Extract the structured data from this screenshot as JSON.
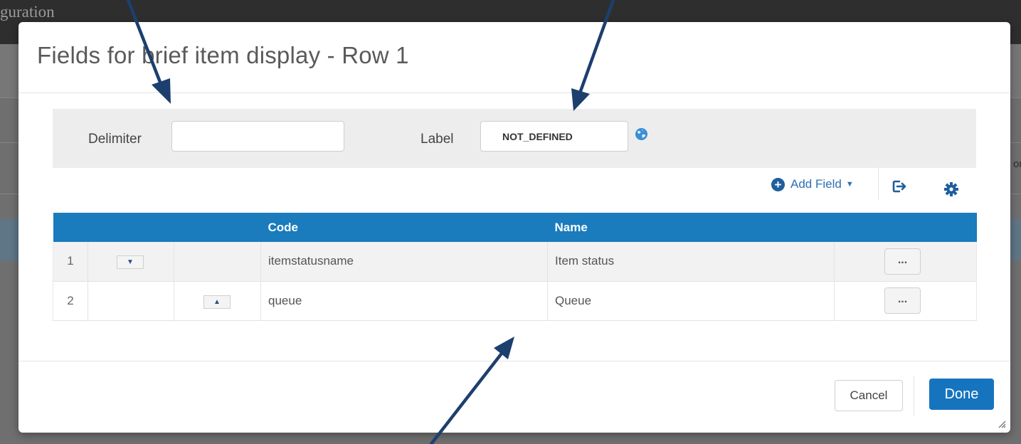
{
  "background": {
    "app_title": "guration",
    "side_text": "or"
  },
  "modal": {
    "title": "Fields for brief item display - Row 1",
    "delimiter": {
      "label": "Delimiter",
      "value": ""
    },
    "label_field": {
      "label": "Label",
      "value": "NOT_DEFINED",
      "icon": "globe-icon"
    },
    "toolbar": {
      "add_field_label": "Add Field",
      "add_field_icon": "plus-circle-icon",
      "caret_icon": "caret-down-icon",
      "export_icon": "export-icon",
      "settings_icon": "gear-icon"
    },
    "table": {
      "headers": [
        "",
        "",
        "",
        "Code",
        "Name",
        ""
      ],
      "rows": [
        {
          "index": "1",
          "code": "itemstatusname",
          "name": "Item status",
          "actions_label": "..."
        },
        {
          "index": "2",
          "code": "queue",
          "name": "Queue",
          "actions_label": "..."
        }
      ]
    },
    "footer": {
      "cancel_label": "Cancel",
      "done_label": "Done"
    }
  },
  "colors": {
    "header_blue": "#1a7bbd",
    "done_blue": "#1674bf",
    "arrow_navy": "#1d3f6e",
    "link_blue": "#2c6fb4"
  }
}
